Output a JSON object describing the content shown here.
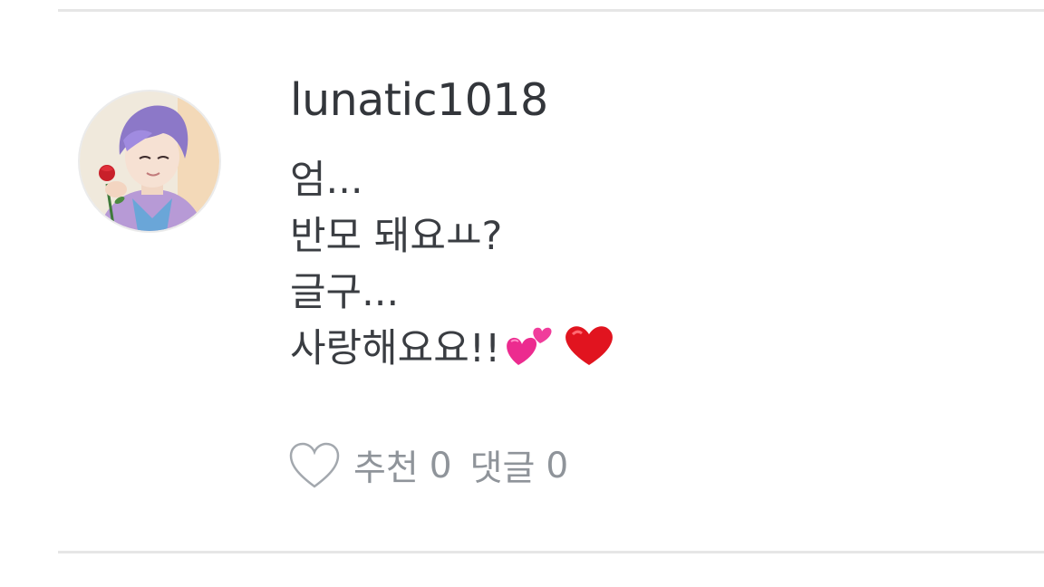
{
  "comment": {
    "username": "lunatic1018",
    "lines": [
      "엄...",
      "반모 돼요ㅛ?",
      "글구...",
      "사랑해요요!!"
    ],
    "emojis": [
      "two-hearts",
      "red-heart"
    ],
    "like_label": "추천",
    "like_count": "0",
    "reply_label": "댓글",
    "reply_count": "0"
  },
  "colors": {
    "text": "#3a3d42",
    "muted": "#8f949a",
    "divider": "#e6e6e6"
  }
}
